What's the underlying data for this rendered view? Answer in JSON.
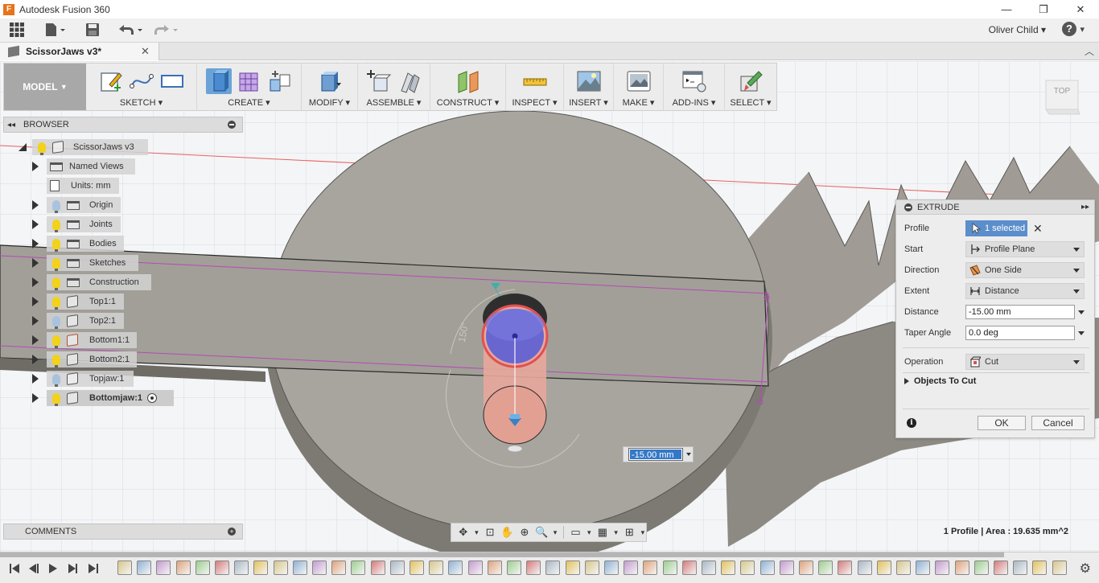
{
  "app": {
    "title": "Autodesk Fusion 360",
    "logo_letter": "F"
  },
  "window_controls": {
    "minimize": "—",
    "restore": "❐",
    "close": "✕"
  },
  "quick_access": {
    "user_name": "Oliver Child",
    "help_glyph": "?"
  },
  "document_tab": {
    "title": "ScissorJaws v3*",
    "close": "✕"
  },
  "toolbar": {
    "workspace": "MODEL",
    "groups": [
      {
        "label": "SKETCH"
      },
      {
        "label": "CREATE"
      },
      {
        "label": "MODIFY"
      },
      {
        "label": "ASSEMBLE"
      },
      {
        "label": "CONSTRUCT"
      },
      {
        "label": "INSPECT"
      },
      {
        "label": "INSERT"
      },
      {
        "label": "MAKE"
      },
      {
        "label": "ADD-INS"
      },
      {
        "label": "SELECT"
      }
    ]
  },
  "browser": {
    "title": "BROWSER",
    "root": "ScissorJaws v3",
    "items": [
      {
        "label": "Named Views"
      },
      {
        "label": "Units: mm"
      },
      {
        "label": "Origin"
      },
      {
        "label": "Joints"
      },
      {
        "label": "Bodies"
      },
      {
        "label": "Sketches"
      },
      {
        "label": "Construction"
      },
      {
        "label": "Top1:1"
      },
      {
        "label": "Top2:1"
      },
      {
        "label": "Bottom1:1"
      },
      {
        "label": "Bottom2:1"
      },
      {
        "label": "Topjaw:1"
      },
      {
        "label": "Bottomjaw:1"
      }
    ]
  },
  "comments": {
    "title": "COMMENTS"
  },
  "status": {
    "text": "1 Profile | Area : 19.635 mm^2"
  },
  "viewcube": {
    "label": "TOP"
  },
  "viewport_labels": {
    "angle": "150°"
  },
  "floating_input": {
    "value": "-15.00 mm"
  },
  "extrude_dialog": {
    "title": "EXTRUDE",
    "profile_label": "Profile",
    "profile_value": "1 selected",
    "start_label": "Start",
    "start_value": "Profile Plane",
    "direction_label": "Direction",
    "direction_value": "One Side",
    "extent_label": "Extent",
    "extent_value": "Distance",
    "distance_label": "Distance",
    "distance_value": "-15.00 mm",
    "taper_label": "Taper Angle",
    "taper_value": "0.0 deg",
    "operation_label": "Operation",
    "operation_value": "Cut",
    "objects_to_cut": "Objects To Cut",
    "ok": "OK",
    "cancel": "Cancel"
  },
  "colors": {
    "active_blue": "#6aa3d8",
    "selection_blue": "#5b8ecb",
    "body_grey": "#a5a29c",
    "cut_preview": "#e8a79b"
  }
}
